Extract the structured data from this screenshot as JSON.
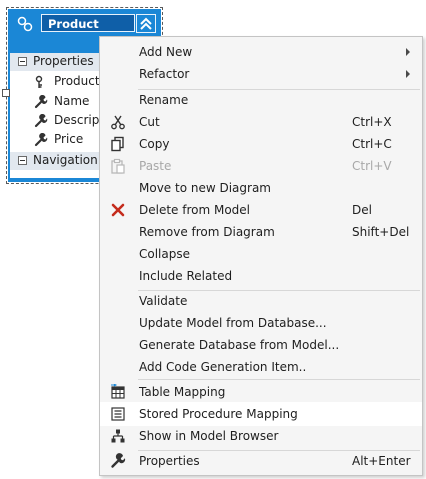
{
  "entity": {
    "title": "Product",
    "sections": {
      "properties_label": "Properties",
      "navigation_label": "Navigation Pr"
    },
    "properties": [
      {
        "name": "ProductId",
        "icon": "key-icon"
      },
      {
        "name": "Name",
        "icon": "wrench-icon"
      },
      {
        "name": "Descriptio",
        "icon": "wrench-icon"
      },
      {
        "name": "Price",
        "icon": "wrench-icon"
      }
    ]
  },
  "menu": {
    "items": [
      {
        "label": "Add New",
        "submenu": true
      },
      {
        "label": "Refactor",
        "submenu": true
      },
      {
        "label": "Rename"
      },
      {
        "label": "Cut",
        "shortcut": "Ctrl+X",
        "icon": "scissors-icon"
      },
      {
        "label": "Copy",
        "shortcut": "Ctrl+C",
        "icon": "copy-icon"
      },
      {
        "label": "Paste",
        "shortcut": "Ctrl+V",
        "icon": "paste-icon",
        "disabled": true
      },
      {
        "label": "Move to new Diagram"
      },
      {
        "label": "Delete from Model",
        "shortcut": "Del",
        "icon": "delete-icon"
      },
      {
        "label": "Remove from Diagram",
        "shortcut": "Shift+Del"
      },
      {
        "label": "Collapse"
      },
      {
        "label": "Include Related"
      },
      {
        "label": "Validate"
      },
      {
        "label": "Update Model from Database..."
      },
      {
        "label": "Generate Database from Model..."
      },
      {
        "label": "Add Code Generation Item.."
      },
      {
        "label": "Table Mapping",
        "icon": "table-mapping-icon"
      },
      {
        "label": "Stored Procedure Mapping",
        "icon": "stored-procedure-icon",
        "highlighted": true
      },
      {
        "label": "Show in Model Browser",
        "icon": "model-browser-icon"
      },
      {
        "label": "Properties",
        "shortcut": "Alt+Enter",
        "icon": "wrench-icon"
      }
    ]
  },
  "colors": {
    "entity_blue": "#1b87d6",
    "delete_red": "#c42b1c",
    "menu_bg": "#f5f5f5"
  }
}
